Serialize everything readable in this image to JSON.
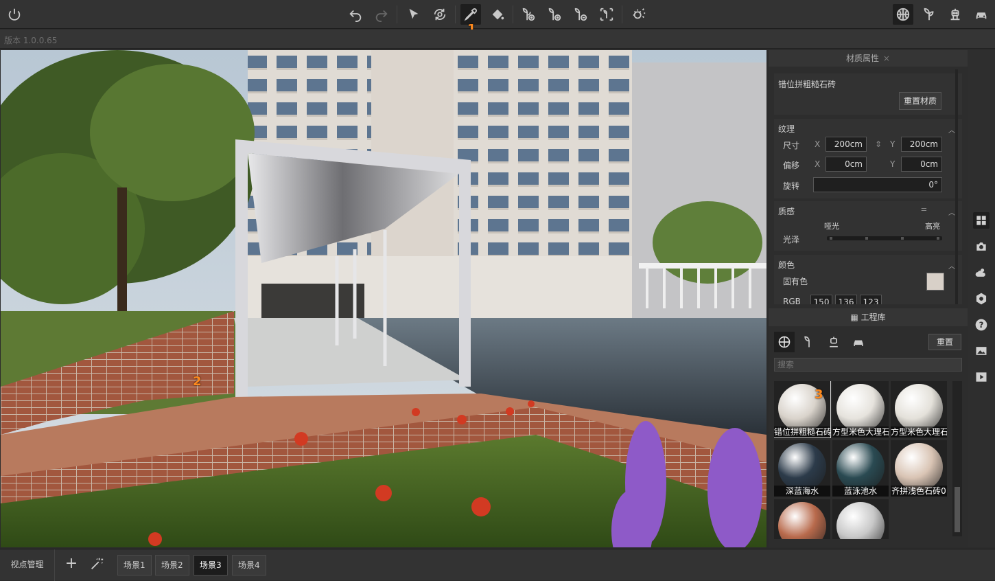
{
  "toolbar": {
    "power": "power-icon",
    "undo": "undo-icon",
    "redo": "redo-icon",
    "select": "pointer-icon",
    "orbit": "orbit-icon",
    "eyedropper": "eyedropper-icon",
    "paint_bucket": "paint-bucket-icon",
    "plant_add_1": "plant-add-icon",
    "plant_add_2": "plant-add-icon",
    "plant_remove": "plant-remove-icon",
    "plant_select": "plant-select-icon",
    "weather": "weather-icon",
    "right_tabs": [
      "material-ball-icon",
      "plant-icon",
      "robot-icon",
      "car-icon"
    ]
  },
  "markers": {
    "m1": "1",
    "m2": "2",
    "m3": "3"
  },
  "version_text": "版本 1.0.0.65",
  "material_panel": {
    "title": "材质属性",
    "close": "×",
    "material_name": "错位拼粗糙石砖",
    "reset_material": "重置材质",
    "texture": {
      "header": "纹理",
      "size_label": "尺寸",
      "offset_label": "偏移",
      "rotation_label": "旋转",
      "x": "X",
      "y": "Y",
      "size_x": "200cm",
      "size_y": "200cm",
      "offset_x": "0cm",
      "offset_y": "0cm",
      "rotation": "0°"
    },
    "quality": {
      "header": "质感",
      "matte": "哑光",
      "glossy": "高亮",
      "gloss_label": "光泽",
      "gloss_level": 0.0
    },
    "color": {
      "header": "颜色",
      "inherent": "固有色",
      "swatch": "#d8d0c8",
      "rgb_label": "RGB",
      "r": "150",
      "g": "136",
      "b": "123"
    }
  },
  "library": {
    "title": "工程库",
    "reset": "重置",
    "search_placeholder": "搜索",
    "tabs": [
      "material-ball-icon",
      "plant-icon",
      "robot-icon",
      "car-icon"
    ],
    "items": [
      {
        "label": "错位拼粗糙石砖",
        "color": "#d9d3cb"
      },
      {
        "label": "方型米色大理石",
        "color": "#e6e3dd"
      },
      {
        "label": "方型米色大理石",
        "color": "#e4e1da"
      },
      {
        "label": "深蓝海水",
        "color": "#2c3b4a"
      },
      {
        "label": "蓝泳池水",
        "color": "#2a4a52"
      },
      {
        "label": "齐拼浅色石砖0",
        "color": "#d9c4b4"
      },
      {
        "label": "",
        "color": "#b86a4c"
      },
      {
        "label": "",
        "color": "#c8c8c8"
      }
    ]
  },
  "side_icons": [
    "grid-icon",
    "camera-icon",
    "weather-icon",
    "settings-icon",
    "help-icon",
    "image-icon",
    "play-icon"
  ],
  "bottom": {
    "viewpoint_manage": "视点管理",
    "add": "add-icon",
    "magic": "magic-wand-icon",
    "scenes": [
      "场景1",
      "场景2",
      "场景3",
      "场景4"
    ],
    "active_scene": "场景3"
  }
}
